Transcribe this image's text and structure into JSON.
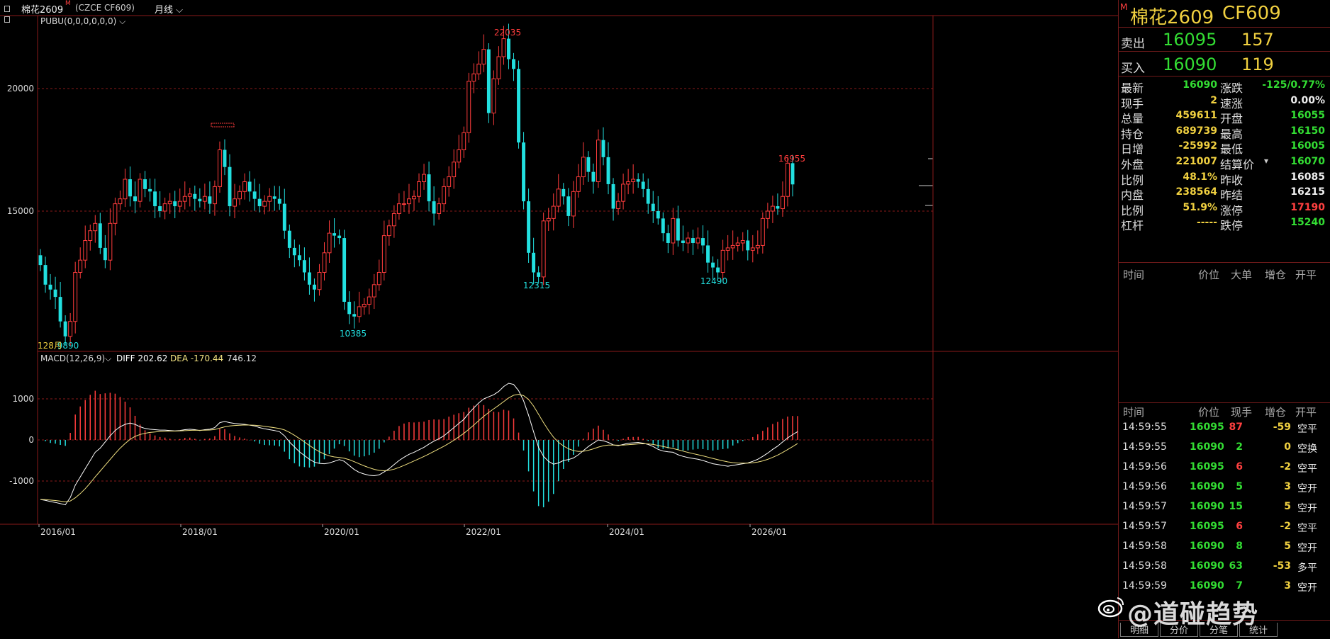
{
  "header": {
    "symbol_label": "棉花2609",
    "symbol_mark": "M",
    "exchange_code": "(CZCE CF609)",
    "period_label": "月线"
  },
  "indicator_main": {
    "label": "PUBU(0,0,0,0,0,0)"
  },
  "indicator_macd": {
    "label": "MACD(12,26,9)",
    "diff_label": "DIFF 202.62",
    "dea_label": "DEA -170.44",
    "macd_value": "746.12"
  },
  "colors": {
    "up": "#ff3c3c",
    "down": "#22e0e0",
    "grid": "#8a1a1a",
    "text_green": "#33dd33",
    "text_yellow": "#f0d040",
    "text_red": "#ff4040"
  },
  "chart_data": {
    "type": "candlestick",
    "x_tick_labels": [
      "2016/01",
      "2018/01",
      "2020/01",
      "2022/01",
      "2024/01",
      "2026/01"
    ],
    "price_ticks": [
      15000,
      20000
    ],
    "macd_ticks": [
      1000,
      0,
      -1000
    ],
    "price_annotations": [
      {
        "label": "22035",
        "value": 22035
      },
      {
        "label": "16955",
        "value": 16955
      },
      {
        "label": "12315",
        "value": 12315
      },
      {
        "label": "12490",
        "value": 12490
      },
      {
        "label": "10385",
        "value": 10385
      },
      {
        "label": "9890",
        "value": 9890
      }
    ],
    "first_bar_label": "128月",
    "monthly_close": [
      12800,
      12000,
      11800,
      11500,
      10500,
      9890,
      10500,
      12500,
      13000,
      13800,
      14200,
      14500,
      13500,
      13000,
      14500,
      15300,
      15500,
      16300,
      15600,
      15400,
      16300,
      15900,
      15800,
      15200,
      15000,
      15300,
      15400,
      15200,
      15400,
      15600,
      15700,
      15500,
      15400,
      15600,
      15300,
      16000,
      17500,
      16800,
      15200,
      15500,
      15800,
      16200,
      15800,
      15500,
      15200,
      15400,
      15600,
      15500,
      15300,
      14200,
      13500,
      13200,
      13000,
      12500,
      12000,
      11800,
      12500,
      13300,
      14100,
      14000,
      13900,
      11300,
      10800,
      10700,
      11100,
      11200,
      11500,
      12000,
      12500,
      14000,
      14400,
      14900,
      15300,
      15300,
      15500,
      15600,
      16200,
      16500,
      15400,
      14900,
      15300,
      16000,
      16400,
      17000,
      17500,
      18200,
      20300,
      20600,
      21000,
      21600,
      19000,
      20400,
      21300,
      22035,
      21200,
      20800,
      17800,
      15400,
      13300,
      12500,
      12315,
      14600,
      14700,
      15200,
      15900,
      15600,
      14800,
      15800,
      16400,
      17200,
      16600,
      16200,
      17900,
      17200,
      16100,
      15100,
      15400,
      16100,
      16200,
      16300,
      16200,
      15900,
      15300,
      15000,
      14700,
      14100,
      13700,
      14700,
      13800,
      13700,
      13900,
      13700,
      13900,
      13600,
      12900,
      12700,
      12500,
      13400,
      13500,
      13600,
      13700,
      13800,
      13400,
      13500,
      13600,
      14700,
      15000,
      15200,
      15100,
      15600,
      16955,
      16090
    ],
    "macd_diff": [
      -1450,
      -1470,
      -1500,
      -1520,
      -1550,
      -1580,
      -1400,
      -1100,
      -900,
      -700,
      -500,
      -300,
      -200,
      -50,
      100,
      230,
      320,
      380,
      410,
      380,
      320,
      280,
      260,
      250,
      240,
      240,
      230,
      220,
      230,
      250,
      260,
      250,
      230,
      250,
      260,
      300,
      420,
      450,
      420,
      400,
      390,
      380,
      360,
      340,
      300,
      270,
      250,
      230,
      200,
      100,
      -50,
      -170,
      -290,
      -380,
      -470,
      -540,
      -570,
      -580,
      -560,
      -520,
      -480,
      -520,
      -620,
      -720,
      -790,
      -830,
      -860,
      -870,
      -850,
      -780,
      -700,
      -600,
      -500,
      -420,
      -350,
      -300,
      -240,
      -180,
      -100,
      -30,
      30,
      100,
      200,
      300,
      400,
      500,
      650,
      780,
      900,
      1000,
      1050,
      1100,
      1180,
      1300,
      1380,
      1350,
      1200,
      950,
      600,
      200,
      -180,
      -400,
      -520,
      -590,
      -560,
      -500,
      -480,
      -440,
      -360,
      -260,
      -160,
      -80,
      0,
      -20,
      -60,
      -120,
      -140,
      -110,
      -80,
      -70,
      -60,
      -80,
      -110,
      -160,
      -230,
      -270,
      -290,
      -300,
      -360,
      -400,
      -430,
      -450,
      -470,
      -500,
      -540,
      -580,
      -600,
      -620,
      -640,
      -620,
      -600,
      -580,
      -560,
      -520,
      -470,
      -400,
      -320,
      -230,
      -150,
      -50,
      50,
      130,
      202
    ]
  },
  "quote": {
    "title": "棉花2609",
    "code": "CF609",
    "mark": "M",
    "sell_label": "卖出",
    "sell_price": "16095",
    "sell_vol": "157",
    "buy_label": "买入",
    "buy_price": "16090",
    "buy_vol": "119"
  },
  "stats": [
    {
      "l1": "最新",
      "v1": "16090",
      "c1": "green",
      "l2": "涨跌",
      "v2": "-125/0.77%",
      "c2": "green"
    },
    {
      "l1": "现手",
      "v1": "2",
      "c1": "yellow",
      "l2": "速涨",
      "v2": "0.00%",
      "c2": "white"
    },
    {
      "l1": "总量",
      "v1": "459611",
      "c1": "yellow",
      "l2": "开盘",
      "v2": "16055",
      "c2": "green"
    },
    {
      "l1": "持仓",
      "v1": "689739",
      "c1": "yellow",
      "l2": "最高",
      "v2": "16150",
      "c2": "green"
    },
    {
      "l1": "日增",
      "v1": "-25992",
      "c1": "yellow",
      "l2": "最低",
      "v2": "16005",
      "c2": "green"
    },
    {
      "l1": "外盘",
      "v1": "221007",
      "c1": "yellow",
      "l2": "结算价",
      "v2": "16070",
      "c2": "green"
    },
    {
      "l1": "比例",
      "v1": "48.1%",
      "c1": "yellow",
      "l2": "昨收",
      "v2": "16085",
      "c2": "white"
    },
    {
      "l1": "内盘",
      "v1": "238564",
      "c1": "yellow",
      "l2": "昨结",
      "v2": "16215",
      "c2": "white"
    },
    {
      "l1": "比例",
      "v1": "51.9%",
      "c1": "yellow",
      "l2": "涨停",
      "v2": "17190",
      "c2": "red"
    },
    {
      "l1": "杠杆",
      "v1": "-----",
      "c1": "yellow",
      "l2": "跌停",
      "v2": "15240",
      "c2": "green"
    }
  ],
  "big_order_head": [
    "时间",
    "价位",
    "大单",
    "增仓",
    "开平"
  ],
  "tick_head": [
    "时间",
    "价位",
    "现手",
    "增仓",
    "开平"
  ],
  "ticks": [
    {
      "time": "14:59:55",
      "price": "16095",
      "vol": "87",
      "vcol": "red",
      "chg": "-59",
      "type": "空平"
    },
    {
      "time": "14:59:55",
      "price": "16090",
      "vol": "2",
      "vcol": "green",
      "chg": "0",
      "type": "空换"
    },
    {
      "time": "14:59:56",
      "price": "16095",
      "vol": "6",
      "vcol": "red",
      "chg": "-2",
      "type": "空平"
    },
    {
      "time": "14:59:56",
      "price": "16090",
      "vol": "5",
      "vcol": "green",
      "chg": "3",
      "type": "空开"
    },
    {
      "time": "14:59:57",
      "price": "16090",
      "vol": "15",
      "vcol": "green",
      "chg": "5",
      "type": "空开"
    },
    {
      "time": "14:59:57",
      "price": "16095",
      "vol": "6",
      "vcol": "red",
      "chg": "-2",
      "type": "空平"
    },
    {
      "time": "14:59:58",
      "price": "16090",
      "vol": "8",
      "vcol": "green",
      "chg": "5",
      "type": "空开"
    },
    {
      "time": "14:59:58",
      "price": "16090",
      "vol": "63",
      "vcol": "green",
      "chg": "-53",
      "type": "多平"
    },
    {
      "time": "14:59:59",
      "price": "16090",
      "vol": "7",
      "vcol": "green",
      "chg": "3",
      "type": "空开"
    }
  ],
  "tabs": [
    "明细",
    "分价",
    "分笔",
    "统计"
  ],
  "watermark": "@道碰趋势"
}
